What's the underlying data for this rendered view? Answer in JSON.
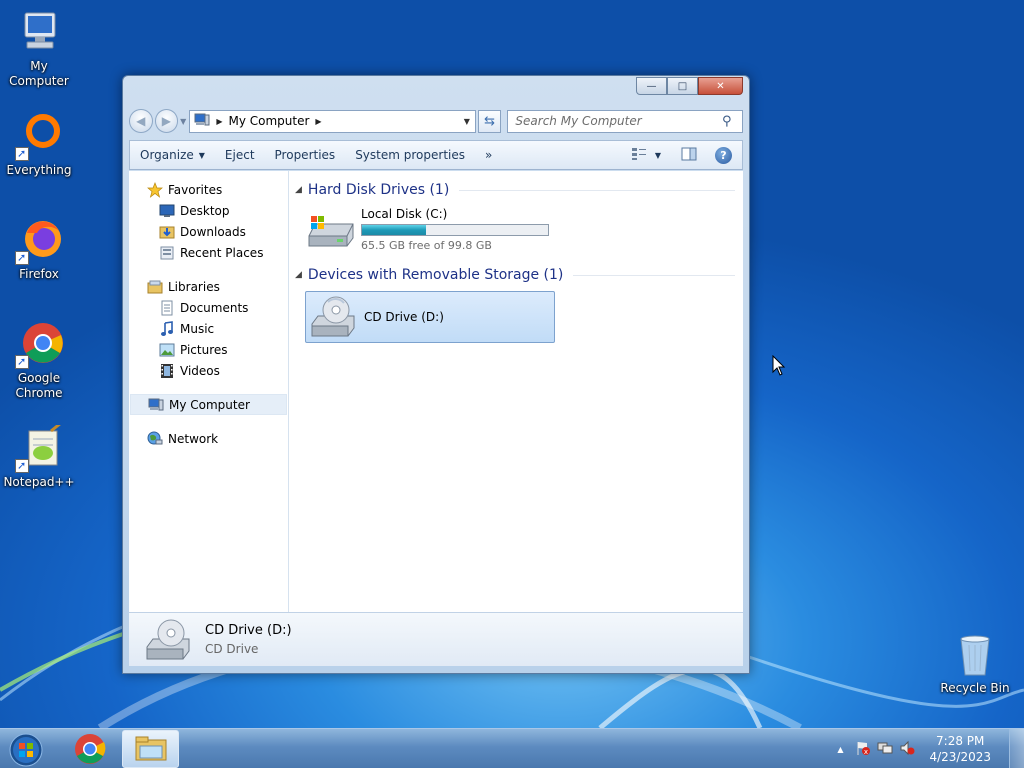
{
  "desktop": {
    "icons": [
      {
        "label": "My Computer"
      },
      {
        "label": "Everything"
      },
      {
        "label": "Firefox"
      },
      {
        "label": "Google Chrome"
      },
      {
        "label": "Notepad++"
      },
      {
        "label": "Recycle Bin"
      }
    ]
  },
  "window": {
    "caption_buttons": {
      "minimize": "—",
      "maximize": "□",
      "close": "✕"
    },
    "address": {
      "location": "My Computer"
    },
    "search": {
      "placeholder": "Search My Computer"
    },
    "toolbar": {
      "organize": "Organize",
      "eject": "Eject",
      "properties": "Properties",
      "system_properties": "System properties",
      "more": "»"
    },
    "nav": {
      "favorites": "Favorites",
      "desktop": "Desktop",
      "downloads": "Downloads",
      "recent_places": "Recent Places",
      "libraries": "Libraries",
      "documents": "Documents",
      "music": "Music",
      "pictures": "Pictures",
      "videos": "Videos",
      "my_computer": "My Computer",
      "network": "Network"
    },
    "groups": {
      "hdd": "Hard Disk Drives (1)",
      "removable": "Devices with Removable Storage (1)"
    },
    "local_disk": {
      "name": "Local Disk (C:)",
      "free_text": "65.5 GB free of 99.8 GB",
      "free_gb": 65.5,
      "total_gb": 99.8
    },
    "cd_drive": {
      "name": "CD Drive (D:)"
    },
    "details": {
      "name": "CD Drive (D:)",
      "type": "CD Drive"
    }
  },
  "taskbar": {
    "time": "7:28 PM",
    "date": "4/23/2023"
  },
  "colors": {
    "accent": "#1e3287",
    "usage_bar": "#1e9ab8",
    "selection": "#c1dcf7"
  }
}
